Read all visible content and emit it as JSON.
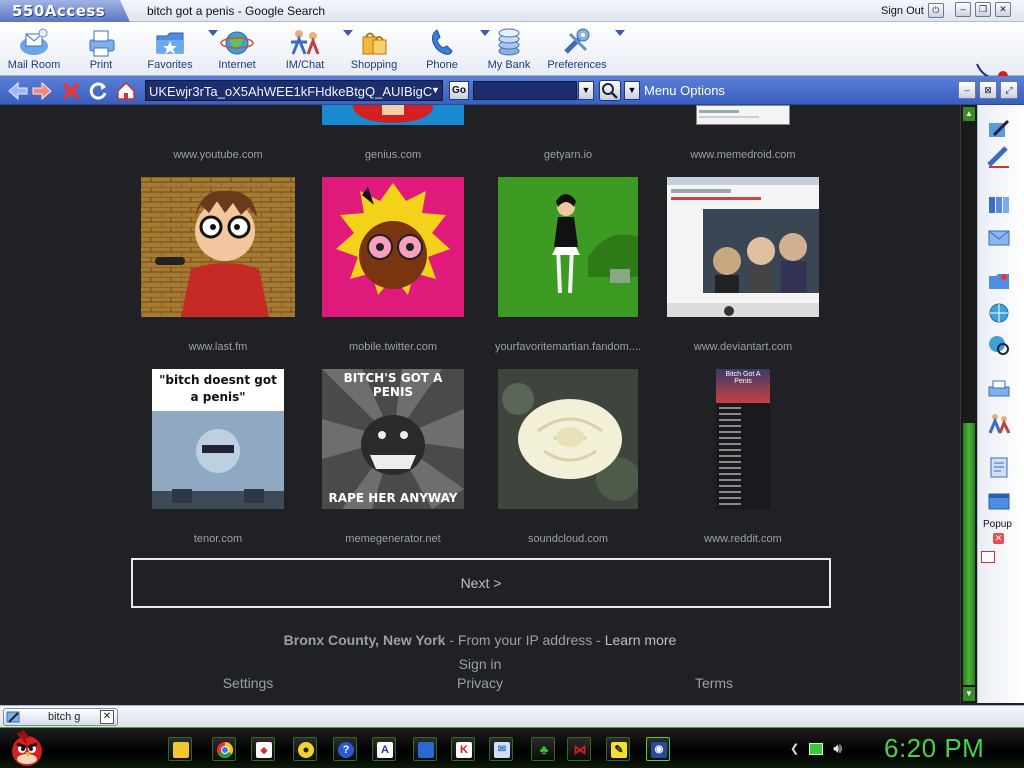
{
  "titlebar": {
    "app_name": "550Access",
    "window_title": "bitch got a penis - Google Search",
    "sign_out": "Sign Out"
  },
  "toolbar": {
    "items": [
      {
        "label": "Mail Room",
        "icon": "mail-room-icon"
      },
      {
        "label": "Print",
        "icon": "print-icon"
      },
      {
        "label": "Favorites",
        "icon": "favorites-icon"
      },
      {
        "label": "Internet",
        "icon": "internet-icon"
      },
      {
        "label": "IM/Chat",
        "icon": "chat-icon"
      },
      {
        "label": "Shopping",
        "icon": "shopping-icon"
      },
      {
        "label": "Phone",
        "icon": "phone-icon"
      },
      {
        "label": "My Bank",
        "icon": "bank-icon"
      },
      {
        "label": "Preferences",
        "icon": "preferences-icon"
      }
    ]
  },
  "addressbar": {
    "url": "UKEwjr3rTa_oX5AhWEE1kFHdkeBtgQ_AUIBigC",
    "go_label": "Go",
    "search_value": "",
    "menu_options": "Menu Options"
  },
  "results": {
    "row0_sites": [
      "www.youtube.com",
      "genius.com",
      "getyarn.io",
      "www.memedroid.com"
    ],
    "row1_sites": [
      "www.last.fm",
      "mobile.twitter.com",
      "yourfavoritemartian.fandom....",
      "www.deviantart.com"
    ],
    "row2_sites": [
      "tenor.com",
      "memegenerator.net",
      "soundcloud.com",
      "www.reddit.com"
    ],
    "tenor_caption": "\"bitch doesnt got a penis\"",
    "meme_top": "BITCH'S GOT A PENIS",
    "meme_bottom": "RAPE HER ANYWAY",
    "reddit_title": "Bitch Got A Penis"
  },
  "next_button": "Next >",
  "footer": {
    "location": "Bronx County, New York",
    "ip_text": " - From your IP address - ",
    "learn_more": "Learn more",
    "sign_in": "Sign in",
    "settings": "Settings",
    "privacy": "Privacy",
    "terms": "Terms"
  },
  "sidebar": {
    "popup_label": "Popup"
  },
  "tabs": [
    {
      "label": "bitch g"
    }
  ],
  "taskbar": {
    "clock": "6:20 PM"
  },
  "colors": {
    "accent": "#3b5fbf",
    "content_bg": "#202124",
    "clock": "#4ad14a"
  }
}
